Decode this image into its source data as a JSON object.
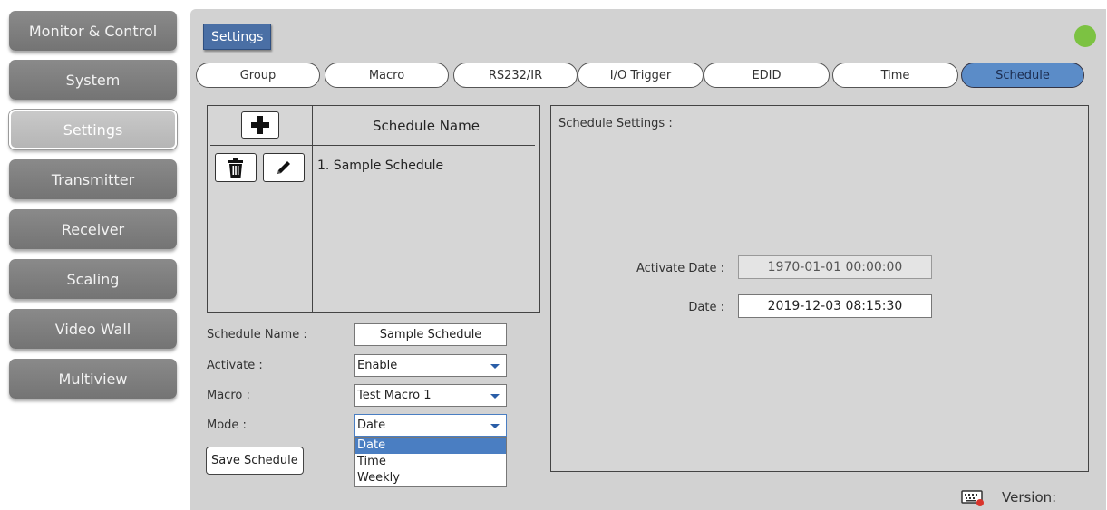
{
  "sidebar": {
    "items": [
      {
        "label": "Monitor & Control"
      },
      {
        "label": "System"
      },
      {
        "label": "Settings"
      },
      {
        "label": "Transmitter"
      },
      {
        "label": "Receiver"
      },
      {
        "label": "Scaling"
      },
      {
        "label": "Video Wall"
      },
      {
        "label": "Multiview"
      }
    ]
  },
  "header": {
    "title": "Settings",
    "status_color": "#7cc242"
  },
  "tabs": [
    {
      "label": "Group"
    },
    {
      "label": "Macro"
    },
    {
      "label": "RS232/IR"
    },
    {
      "label": "I/O Trigger"
    },
    {
      "label": "EDID"
    },
    {
      "label": "Time"
    },
    {
      "label": "Schedule"
    }
  ],
  "schedule_list": {
    "column_header": "Schedule Name",
    "items": [
      {
        "label": "1. Sample Schedule"
      }
    ]
  },
  "form": {
    "name_label": "Schedule Name :",
    "name_value": "Sample Schedule",
    "activate_label": "Activate :",
    "activate_value": "Enable",
    "macro_label": "Macro :",
    "macro_value": "Test Macro 1",
    "mode_label": "Mode :",
    "mode_value": "Date",
    "mode_options": [
      "Date",
      "Time",
      "Weekly"
    ],
    "save_label": "Save Schedule"
  },
  "settings_panel": {
    "title": "Schedule Settings :",
    "activate_date_label": "Activate Date :",
    "activate_date_value": "1970-01-01 00:00:00",
    "date_label": "Date :",
    "date_value": "2019-12-03 08:15:30"
  },
  "footer": {
    "version_label": "Version:"
  },
  "colors": {
    "accent": "#4a6fa5",
    "active_tab": "#5b8cc8",
    "selected_option": "#4a7ec2"
  }
}
